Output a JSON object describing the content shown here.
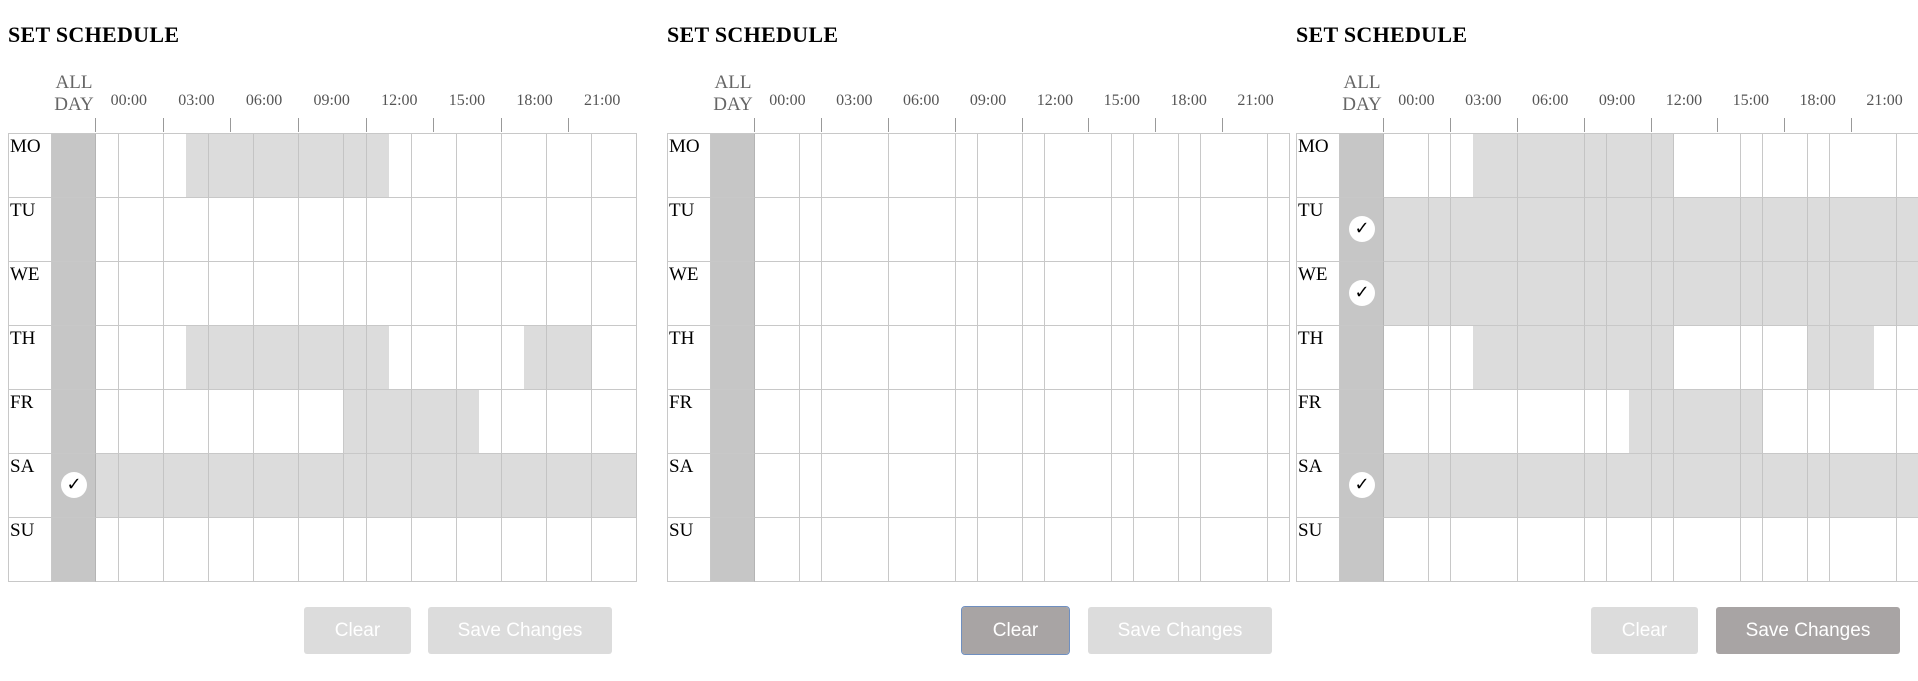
{
  "panels": [
    {
      "title": "SET SCHEDULE",
      "all_day_label": [
        "ALL",
        "DAY"
      ],
      "hour_labels": [
        "00:00",
        "03:00",
        "06:00",
        "09:00",
        "12:00",
        "15:00",
        "18:00",
        "21:00"
      ],
      "days": [
        {
          "label": "MO",
          "all_day": false,
          "active_hours": [
            4,
            5,
            6,
            7,
            8,
            9,
            10,
            11,
            12
          ]
        },
        {
          "label": "TU",
          "all_day": false,
          "active_hours": []
        },
        {
          "label": "WE",
          "all_day": false,
          "active_hours": []
        },
        {
          "label": "TH",
          "all_day": false,
          "active_hours": [
            4,
            5,
            6,
            7,
            8,
            9,
            10,
            11,
            12,
            19,
            20,
            21
          ]
        },
        {
          "label": "FR",
          "all_day": false,
          "active_hours": [
            11,
            12,
            13,
            14,
            15,
            16
          ]
        },
        {
          "label": "SA",
          "all_day": true,
          "active_hours": [
            0,
            1,
            2,
            3,
            4,
            5,
            6,
            7,
            8,
            9,
            10,
            11,
            12,
            13,
            14,
            15,
            16,
            17,
            18,
            19,
            20,
            21,
            22,
            23
          ]
        },
        {
          "label": "SU",
          "all_day": false,
          "active_hours": []
        }
      ],
      "buttons": {
        "clear": "Clear",
        "clear_state": "disabled",
        "save": "Save Changes",
        "save_state": "disabled"
      }
    },
    {
      "title": "SET SCHEDULE",
      "all_day_label": [
        "ALL",
        "DAY"
      ],
      "hour_labels": [
        "00:00",
        "03:00",
        "06:00",
        "09:00",
        "12:00",
        "15:00",
        "18:00",
        "21:00"
      ],
      "days": [
        {
          "label": "MO",
          "all_day": false,
          "active_hours": []
        },
        {
          "label": "TU",
          "all_day": false,
          "active_hours": []
        },
        {
          "label": "WE",
          "all_day": false,
          "active_hours": []
        },
        {
          "label": "TH",
          "all_day": false,
          "active_hours": []
        },
        {
          "label": "FR",
          "all_day": false,
          "active_hours": []
        },
        {
          "label": "SA",
          "all_day": false,
          "active_hours": []
        },
        {
          "label": "SU",
          "all_day": false,
          "active_hours": []
        }
      ],
      "buttons": {
        "clear": "Clear",
        "clear_state": "focused",
        "save": "Save Changes",
        "save_state": "disabled"
      }
    },
    {
      "title": "SET SCHEDULE",
      "all_day_label": [
        "ALL",
        "DAY"
      ],
      "hour_labels": [
        "00:00",
        "03:00",
        "06:00",
        "09:00",
        "12:00",
        "15:00",
        "18:00",
        "21:00"
      ],
      "days": [
        {
          "label": "MO",
          "all_day": false,
          "active_hours": [
            4,
            5,
            6,
            7,
            8,
            9,
            10,
            11,
            12
          ]
        },
        {
          "label": "TU",
          "all_day": true,
          "active_hours": [
            0,
            1,
            2,
            3,
            4,
            5,
            6,
            7,
            8,
            9,
            10,
            11,
            12,
            13,
            14,
            15,
            16,
            17,
            18,
            19,
            20,
            21,
            22,
            23
          ]
        },
        {
          "label": "WE",
          "all_day": true,
          "active_hours": [
            0,
            1,
            2,
            3,
            4,
            5,
            6,
            7,
            8,
            9,
            10,
            11,
            12,
            13,
            14,
            15,
            16,
            17,
            18,
            19,
            20,
            21,
            22,
            23
          ]
        },
        {
          "label": "TH",
          "all_day": false,
          "active_hours": [
            4,
            5,
            6,
            7,
            8,
            9,
            10,
            11,
            12,
            19,
            20,
            21
          ]
        },
        {
          "label": "FR",
          "all_day": false,
          "active_hours": [
            11,
            12,
            13,
            14,
            15,
            16
          ]
        },
        {
          "label": "SA",
          "all_day": true,
          "active_hours": [
            0,
            1,
            2,
            3,
            4,
            5,
            6,
            7,
            8,
            9,
            10,
            11,
            12,
            13,
            14,
            15,
            16,
            17,
            18,
            19,
            20,
            21,
            22,
            23
          ]
        },
        {
          "label": "SU",
          "all_day": false,
          "active_hours": []
        }
      ],
      "buttons": {
        "clear": "Clear",
        "clear_state": "disabled",
        "save": "Save Changes",
        "save_state": "active"
      }
    }
  ],
  "check_glyph": "✓",
  "colors": {
    "all_day_column": "#c6c6c6",
    "active_cell": "#dcdcdc",
    "button_disabled": "#dcdcdc",
    "button_active": "#a8a4a4",
    "focus_outline": "#6f8fc0"
  }
}
